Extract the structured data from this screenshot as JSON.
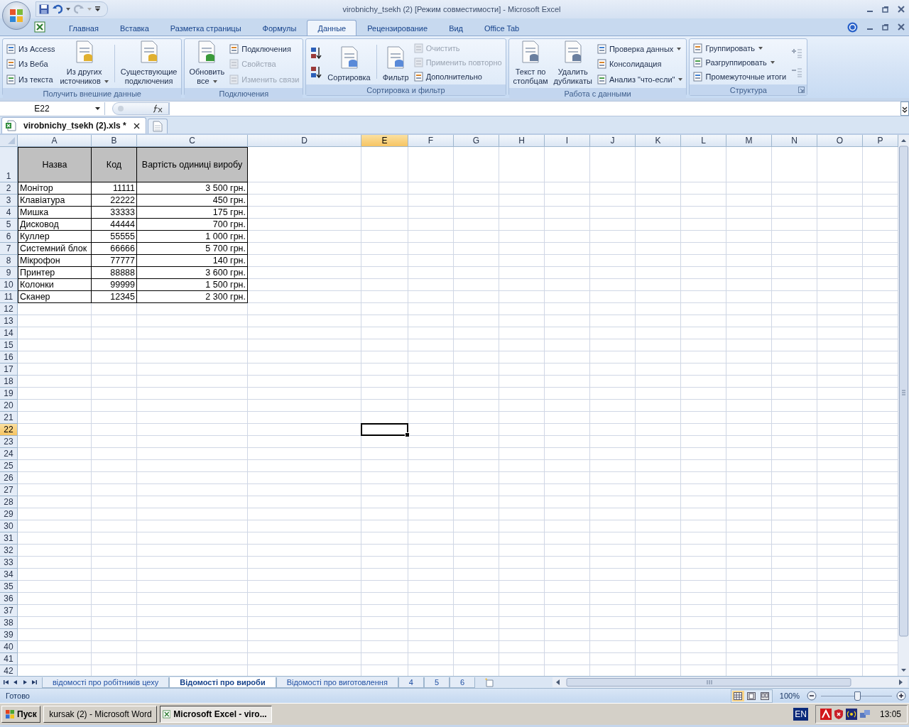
{
  "window": {
    "title": "virobnichy_tsekh (2)  [Режим совместимости] - Microsoft Excel"
  },
  "ribbon_tabs": [
    {
      "label": "Главная",
      "selected": false
    },
    {
      "label": "Вставка",
      "selected": false
    },
    {
      "label": "Разметка страницы",
      "selected": false
    },
    {
      "label": "Формулы",
      "selected": false
    },
    {
      "label": "Данные",
      "selected": true
    },
    {
      "label": "Рецензирование",
      "selected": false
    },
    {
      "label": "Вид",
      "selected": false
    },
    {
      "label": "Office Tab",
      "selected": false
    }
  ],
  "ribbon_groups": [
    {
      "label": "Получить внешние данные",
      "launcher": false,
      "columns": [
        {
          "kind": "stack",
          "items": [
            {
              "label": "Из Access",
              "disabled": false,
              "dropdown": false
            },
            {
              "label": "Из Веба",
              "disabled": false,
              "dropdown": false
            },
            {
              "label": "Из текста",
              "disabled": false,
              "dropdown": false
            }
          ]
        },
        {
          "kind": "large",
          "items": [
            {
              "lines": [
                "Из других",
                "источников"
              ],
              "disabled": false,
              "dropdown": true
            }
          ]
        },
        {
          "kind": "separator"
        },
        {
          "kind": "large",
          "items": [
            {
              "lines": [
                "Существующие",
                "подключения"
              ],
              "disabled": false,
              "dropdown": false
            }
          ]
        }
      ]
    },
    {
      "label": "Подключения",
      "launcher": false,
      "columns": [
        {
          "kind": "large",
          "items": [
            {
              "lines": [
                "Обновить",
                "все"
              ],
              "disabled": false,
              "dropdown": true
            }
          ]
        },
        {
          "kind": "stack",
          "items": [
            {
              "label": "Подключения",
              "disabled": false,
              "dropdown": false
            },
            {
              "label": "Свойства",
              "disabled": true,
              "dropdown": false
            },
            {
              "label": "Изменить связи",
              "disabled": true,
              "dropdown": false
            }
          ]
        }
      ]
    },
    {
      "label": "Сортировка и фильтр",
      "launcher": false,
      "columns": [
        {
          "kind": "sort_buttons"
        },
        {
          "kind": "large",
          "items": [
            {
              "lines": [
                "Сортировка"
              ],
              "disabled": false,
              "dropdown": false
            }
          ]
        },
        {
          "kind": "separator"
        },
        {
          "kind": "large",
          "items": [
            {
              "lines": [
                "Фильтр"
              ],
              "disabled": false,
              "dropdown": false
            }
          ]
        },
        {
          "kind": "stack",
          "items": [
            {
              "label": "Очистить",
              "disabled": true,
              "dropdown": false
            },
            {
              "label": "Применить повторно",
              "disabled": true,
              "dropdown": false
            },
            {
              "label": "Дополнительно",
              "disabled": false,
              "dropdown": false
            }
          ]
        }
      ]
    },
    {
      "label": "Работа с данными",
      "launcher": false,
      "columns": [
        {
          "kind": "large",
          "items": [
            {
              "lines": [
                "Текст по",
                "столбцам"
              ],
              "disabled": false,
              "dropdown": false
            }
          ]
        },
        {
          "kind": "large",
          "items": [
            {
              "lines": [
                "Удалить",
                "дубликаты"
              ],
              "disabled": false,
              "dropdown": false
            }
          ]
        },
        {
          "kind": "stack",
          "items": [
            {
              "label": "Проверка данных",
              "disabled": false,
              "dropdown": true
            },
            {
              "label": "Консолидация",
              "disabled": false,
              "dropdown": false
            },
            {
              "label": "Анализ \"что-если\"",
              "disabled": false,
              "dropdown": true
            }
          ]
        }
      ]
    },
    {
      "label": "Структура",
      "launcher": true,
      "columns": [
        {
          "kind": "stack",
          "items": [
            {
              "label": "Группировать",
              "disabled": false,
              "dropdown": true
            },
            {
              "label": "Разгруппировать",
              "disabled": false,
              "dropdown": true
            },
            {
              "label": "Промежуточные итоги",
              "disabled": false,
              "dropdown": false
            }
          ]
        },
        {
          "kind": "detail_buttons"
        }
      ]
    }
  ],
  "name_box": "E22",
  "doc_tabs": [
    {
      "label": "virobnichy_tsekh (2).xls *",
      "selected": true
    }
  ],
  "grid": {
    "columns": [
      {
        "label": "A",
        "selected": false
      },
      {
        "label": "B",
        "selected": false
      },
      {
        "label": "C",
        "selected": false
      },
      {
        "label": "D",
        "selected": false
      },
      {
        "label": "E",
        "selected": true
      },
      {
        "label": "F",
        "selected": false
      },
      {
        "label": "G",
        "selected": false
      },
      {
        "label": "H",
        "selected": false
      },
      {
        "label": "I",
        "selected": false
      },
      {
        "label": "J",
        "selected": false
      },
      {
        "label": "K",
        "selected": false
      },
      {
        "label": "L",
        "selected": false
      },
      {
        "label": "M",
        "selected": false
      },
      {
        "label": "N",
        "selected": false
      },
      {
        "label": "O",
        "selected": false
      },
      {
        "label": "P",
        "selected": false
      }
    ],
    "rows": [
      {
        "label": "1",
        "selected": false,
        "kind": "header",
        "cells": [
          "Назва",
          "Код",
          "Вартість одиниці виробу"
        ]
      },
      {
        "label": "2",
        "selected": false,
        "kind": "data",
        "cells": [
          "Монітор",
          "11111",
          "3 500 грн."
        ]
      },
      {
        "label": "3",
        "selected": false,
        "kind": "data",
        "cells": [
          "Клавіатура",
          "22222",
          "450 грн."
        ]
      },
      {
        "label": "4",
        "selected": false,
        "kind": "data",
        "cells": [
          "Мишка",
          "33333",
          "175 грн."
        ]
      },
      {
        "label": "5",
        "selected": false,
        "kind": "data",
        "cells": [
          "Дисковод",
          "44444",
          "700 грн."
        ]
      },
      {
        "label": "6",
        "selected": false,
        "kind": "data",
        "cells": [
          "Куллер",
          "55555",
          "1 000 грн."
        ]
      },
      {
        "label": "7",
        "selected": false,
        "kind": "data",
        "cells": [
          "Системний блок",
          "66666",
          "5 700 грн."
        ]
      },
      {
        "label": "8",
        "selected": false,
        "kind": "data",
        "cells": [
          "Мікрофон",
          "77777",
          "140 грн."
        ]
      },
      {
        "label": "9",
        "selected": false,
        "kind": "data",
        "cells": [
          "Принтер",
          "88888",
          "3 600 грн."
        ]
      },
      {
        "label": "10",
        "selected": false,
        "kind": "data",
        "cells": [
          "Колонки",
          "99999",
          "1 500 грн."
        ]
      },
      {
        "label": "11",
        "selected": false,
        "kind": "data",
        "cells": [
          "Сканер",
          "12345",
          "2 300 грн."
        ]
      },
      {
        "label": "12",
        "selected": false,
        "kind": "empty"
      },
      {
        "label": "13",
        "selected": false,
        "kind": "empty"
      },
      {
        "label": "14",
        "selected": false,
        "kind": "empty"
      },
      {
        "label": "15",
        "selected": false,
        "kind": "empty"
      },
      {
        "label": "16",
        "selected": false,
        "kind": "empty"
      },
      {
        "label": "17",
        "selected": false,
        "kind": "empty"
      },
      {
        "label": "18",
        "selected": false,
        "kind": "empty"
      },
      {
        "label": "19",
        "selected": false,
        "kind": "empty"
      },
      {
        "label": "20",
        "selected": false,
        "kind": "empty"
      },
      {
        "label": "21",
        "selected": false,
        "kind": "empty"
      },
      {
        "label": "22",
        "selected": true,
        "kind": "empty"
      },
      {
        "label": "23",
        "selected": false,
        "kind": "empty"
      },
      {
        "label": "24",
        "selected": false,
        "kind": "empty"
      },
      {
        "label": "25",
        "selected": false,
        "kind": "empty"
      },
      {
        "label": "26",
        "selected": false,
        "kind": "empty"
      },
      {
        "label": "27",
        "selected": false,
        "kind": "empty"
      },
      {
        "label": "28",
        "selected": false,
        "kind": "empty"
      },
      {
        "label": "29",
        "selected": false,
        "kind": "empty"
      },
      {
        "label": "30",
        "selected": false,
        "kind": "empty"
      },
      {
        "label": "31",
        "selected": false,
        "kind": "empty"
      },
      {
        "label": "32",
        "selected": false,
        "kind": "empty"
      },
      {
        "label": "33",
        "selected": false,
        "kind": "empty"
      },
      {
        "label": "34",
        "selected": false,
        "kind": "empty"
      },
      {
        "label": "35",
        "selected": false,
        "kind": "empty"
      },
      {
        "label": "36",
        "selected": false,
        "kind": "empty"
      },
      {
        "label": "37",
        "selected": false,
        "kind": "empty"
      },
      {
        "label": "38",
        "selected": false,
        "kind": "empty"
      },
      {
        "label": "39",
        "selected": false,
        "kind": "empty"
      },
      {
        "label": "40",
        "selected": false,
        "kind": "empty"
      },
      {
        "label": "41",
        "selected": false,
        "kind": "empty"
      },
      {
        "label": "42",
        "selected": false,
        "kind": "empty"
      }
    ]
  },
  "sheet_tabs": [
    {
      "label": "відомості про робітників цеху",
      "selected": false
    },
    {
      "label": "Відомості про вироби",
      "selected": true
    },
    {
      "label": "Відомості про виготовлення",
      "selected": false
    },
    {
      "label": "4",
      "selected": false
    },
    {
      "label": "5",
      "selected": false
    },
    {
      "label": "6",
      "selected": false
    }
  ],
  "status_bar": {
    "text": "Готово",
    "views": [
      {
        "kind": "normal",
        "selected": true
      },
      {
        "kind": "page_layout",
        "selected": false
      },
      {
        "kind": "page_break",
        "selected": false
      }
    ],
    "zoom": "100%",
    "zoom_slider": {
      "level": 0.5
    }
  },
  "taskbar": {
    "start": "Пуск",
    "tasks": [
      {
        "label": "kursak (2) - Microsoft Word",
        "kind": "word",
        "selected": false
      },
      {
        "label": "Microsoft Excel - viro...",
        "kind": "excel",
        "selected": true
      }
    ],
    "language": "EN",
    "clock": "13:05"
  }
}
